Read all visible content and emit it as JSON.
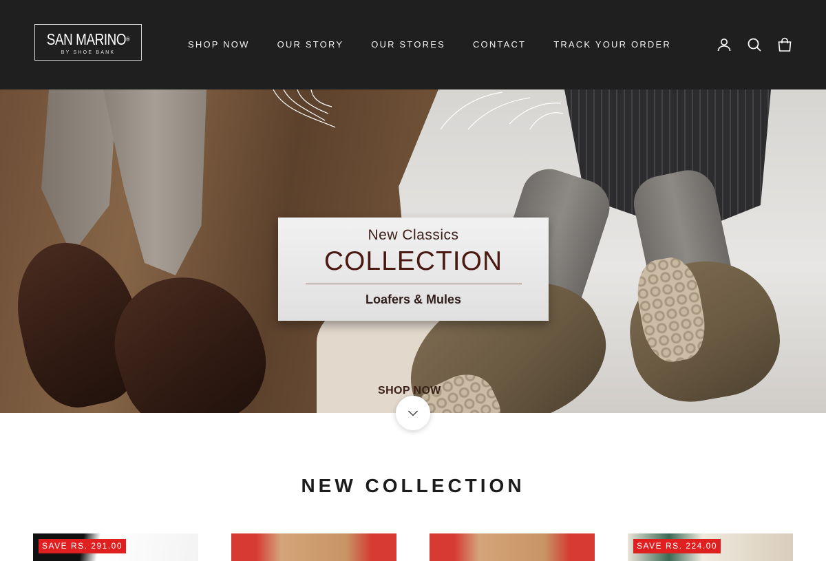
{
  "header": {
    "logo_text": "SAN MARINO",
    "logo_reg": "®",
    "logo_subtitle": "BY SHOE BANK",
    "nav": [
      {
        "label": "SHOP NOW"
      },
      {
        "label": "OUR STORY"
      },
      {
        "label": "OUR STORES"
      },
      {
        "label": "CONTACT"
      },
      {
        "label": "TRACK YOUR ORDER"
      }
    ],
    "icons": [
      "account-icon",
      "search-icon",
      "cart-icon"
    ]
  },
  "hero": {
    "kicker": "New Classics",
    "title": "COLLECTION",
    "subtitle": "Loafers & Mules",
    "cta": "SHOP NOW",
    "slides_total": 6,
    "active_slide": 1
  },
  "section": {
    "title": "NEW COLLECTION"
  },
  "products": [
    {
      "badge": "SAVE RS. 291.00"
    },
    {
      "badge": ""
    },
    {
      "badge": ""
    },
    {
      "badge": "SAVE RS. 224.00"
    }
  ],
  "colors": {
    "header_bg": "#1f1f1f",
    "sale_badge": "#e02020",
    "card_title": "#4a1a12"
  }
}
